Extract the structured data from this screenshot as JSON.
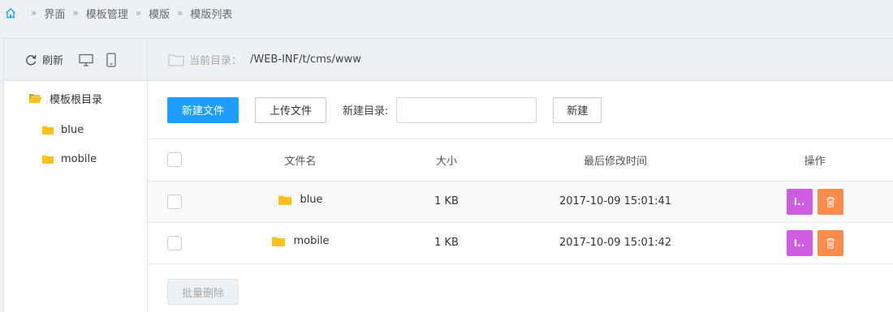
{
  "breadcrumb": {
    "items": [
      "界面",
      "模板管理",
      "模版",
      "模版列表"
    ],
    "separator": "»"
  },
  "left": {
    "refresh_label": "刷新",
    "tree": {
      "root_label": "模板根目录",
      "children": [
        "blue",
        "mobile"
      ]
    }
  },
  "dir": {
    "label": "当前目录：",
    "path": "/WEB-INF/t/cms/www"
  },
  "actions": {
    "new_file": "新建文件",
    "upload": "上传文件",
    "new_dir_label": "新建目录:",
    "new_dir_value": "",
    "create": "新建"
  },
  "table": {
    "headers": {
      "name": "文件名",
      "size": "大小",
      "modified": "最后修改时间",
      "ops": "操作"
    },
    "rows": [
      {
        "name": "blue",
        "size": "1 KB",
        "modified": "2017-10-09 15:01:41",
        "edit": "I.."
      },
      {
        "name": "mobile",
        "size": "1 KB",
        "modified": "2017-10-09 15:01:42",
        "edit": "I.."
      }
    ]
  },
  "bulk_delete": "批量删除",
  "colors": {
    "primary": "#1e9fff",
    "edit": "#d05ce3",
    "delete": "#ff8c4a",
    "folder": "#ffc21c",
    "home_icon": "#1e9fff"
  }
}
